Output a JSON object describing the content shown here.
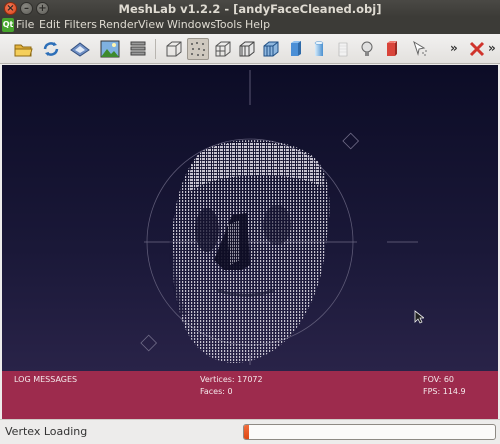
{
  "window": {
    "title": "MeshLab v1.2.2 - [andyFaceCleaned.obj]",
    "close_glyph": "×",
    "min_glyph": "–",
    "max_glyph": "+"
  },
  "menubar": {
    "logo_text": "Qt",
    "items": [
      "File",
      "Edit",
      "Filters",
      "Render",
      "View",
      "Windows",
      "Tools",
      "Help"
    ]
  },
  "toolbar": {
    "buttons": [
      {
        "icon": "open-folder-icon"
      },
      {
        "icon": "reload-icon"
      },
      {
        "icon": "save-icon"
      },
      {
        "icon": "snapshot-icon"
      },
      {
        "icon": "layers-icon"
      },
      {
        "icon": "bounding-box-icon"
      },
      {
        "icon": "points-icon",
        "selected": true
      },
      {
        "icon": "wireframe-icon"
      },
      {
        "icon": "hidden-lines-icon"
      },
      {
        "icon": "flat-lines-icon"
      },
      {
        "icon": "flat-shading-icon"
      },
      {
        "icon": "smooth-shading-icon"
      },
      {
        "icon": "texture-icon"
      },
      {
        "icon": "light-bulb-icon"
      },
      {
        "icon": "color-icon"
      },
      {
        "icon": "select-vertices-icon"
      }
    ],
    "more_glyph_1": "»",
    "more_glyph_2": "»"
  },
  "log": {
    "title": "LOG MESSAGES",
    "vertices": "Vertices: 17072",
    "faces": "Faces: 0",
    "fov": "FOV: 60",
    "fps": "FPS:   114.9"
  },
  "status": {
    "text": "Vertex Loading",
    "progress": 0.02
  },
  "colors": {
    "log_bg": "#9d2b4d",
    "progress_fill": "#dd4814",
    "viewport_top": "#0c0c26",
    "viewport_bottom": "#292348"
  }
}
